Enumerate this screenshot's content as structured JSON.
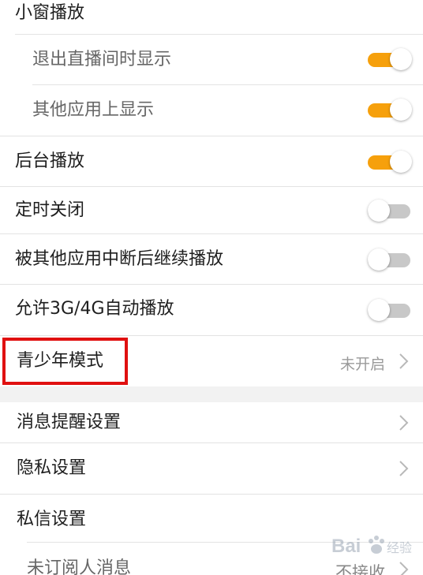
{
  "settings": {
    "pip_header": "小窗播放",
    "pip_exit_room": {
      "label": "退出直播间时显示",
      "enabled": true
    },
    "pip_other_apps": {
      "label": "其他应用上显示",
      "enabled": true
    },
    "background_play": {
      "label": "后台播放",
      "enabled": true
    },
    "timer_close": {
      "label": "定时关闭",
      "enabled": false
    },
    "resume_after_interrupt": {
      "label": "被其他应用中断后继续播放",
      "enabled": false
    },
    "autoplay_mobile": {
      "label": "允许3G/4G自动播放",
      "enabled": false
    },
    "teen_mode": {
      "label": "青少年模式",
      "value": "未开启"
    },
    "notification_settings": {
      "label": "消息提醒设置"
    },
    "privacy_settings": {
      "label": "隐私设置"
    },
    "dm_settings": {
      "label": "私信设置"
    },
    "unsubscribed_messages": {
      "label": "未订阅人消息",
      "value": "不接收"
    }
  },
  "colors": {
    "toggle_on": "#f6a00c",
    "toggle_off": "#c8c8c8",
    "highlight_box": "#e01010"
  },
  "watermark": {
    "text": "经验"
  }
}
